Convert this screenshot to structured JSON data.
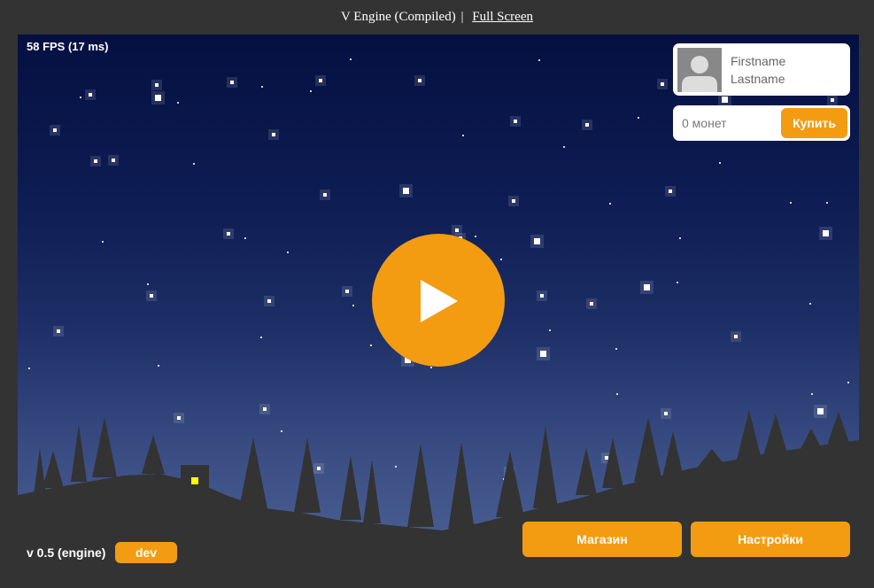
{
  "header": {
    "title": "V Engine (Compiled)",
    "separator": "|",
    "fullscreen_link": "Full Screen"
  },
  "game": {
    "fps": "58 FPS (17 ms)",
    "version": "v 0.5 (engine)",
    "dev_label": "dev",
    "play_icon": "play-icon"
  },
  "profile": {
    "firstname": "Firstname",
    "lastname": "Lastname",
    "avatar_icon": "user-avatar-icon"
  },
  "wallet": {
    "coins": "0 монет",
    "buy_label": "Купить"
  },
  "buttons": {
    "shop": "Магазин",
    "settings": "Настройки"
  },
  "colors": {
    "accent": "#f39c12",
    "page_background": "#333333",
    "sky_top": "#051041",
    "sky_bottom": "#4c6195",
    "foreground": "#333333",
    "window_light": "#ffff00"
  }
}
